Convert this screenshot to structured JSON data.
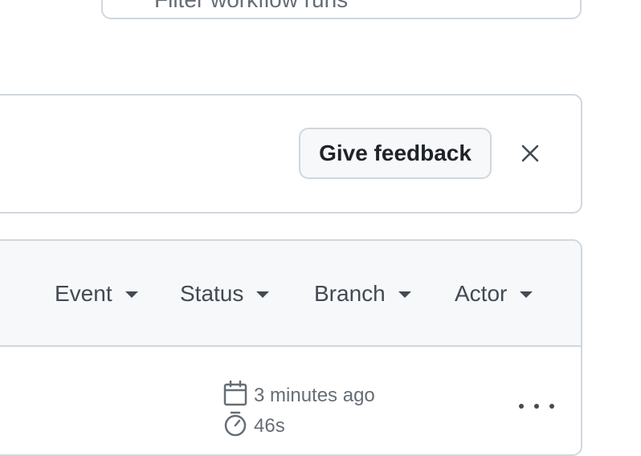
{
  "search": {
    "placeholder": "Filter workflow runs"
  },
  "banner": {
    "feedback_label": "Give feedback",
    "close_icon": "close-icon"
  },
  "filters": [
    {
      "label": "Event"
    },
    {
      "label": "Status"
    },
    {
      "label": "Branch"
    },
    {
      "label": "Actor"
    }
  ],
  "run": {
    "time_ago": "3 minutes ago",
    "duration": "46s",
    "icons": [
      "calendar-icon",
      "stopwatch-icon",
      "kebab-horizontal-icon"
    ]
  },
  "colors": {
    "border": "#d0d7de",
    "header_bg": "#f6f8fa",
    "muted_text": "#656d76",
    "text": "#1f2328"
  }
}
